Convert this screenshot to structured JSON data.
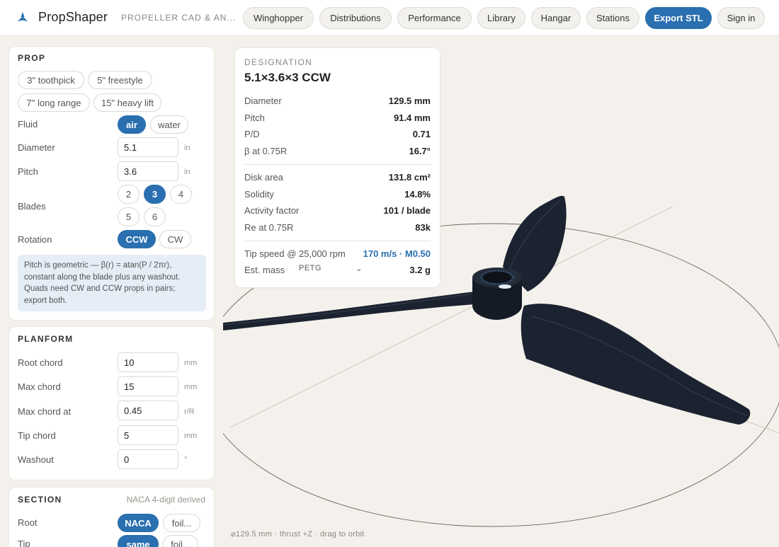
{
  "header": {
    "brand": "PropShaper",
    "tagline": "PROPELLER CAD & AN...",
    "nav": [
      {
        "label": "Winghopper"
      },
      {
        "label": "Distributions"
      },
      {
        "label": "Performance"
      },
      {
        "label": "Library"
      },
      {
        "label": "Hangar"
      },
      {
        "label": "Stations"
      },
      {
        "label": "Export STL"
      },
      {
        "label": "Sign in"
      }
    ],
    "accent_color": "#2a6fb0"
  },
  "prop": {
    "title": "PROP",
    "presets": [
      "3\" toothpick",
      "5\" freestyle",
      "7\" long range",
      "15\" heavy lift"
    ],
    "fluid": {
      "label": "Fluid",
      "options": [
        "air",
        "water"
      ],
      "selected": "air"
    },
    "diameter": {
      "label": "Diameter",
      "value": "5.1",
      "unit": "in"
    },
    "pitch": {
      "label": "Pitch",
      "value": "3.6",
      "unit": "in"
    },
    "blades": {
      "label": "Blades",
      "options": [
        "2",
        "3",
        "4",
        "5",
        "6"
      ],
      "selected": "3"
    },
    "rotation": {
      "label": "Rotation",
      "options": [
        "CCW",
        "CW"
      ],
      "selected": "CCW"
    },
    "info": "Pitch is geometric — β(r) = atan(P / 2πr), constant along the blade plus any washout. Quads need CW and CCW props in pairs; export both."
  },
  "planform": {
    "title": "PLANFORM",
    "fields": [
      {
        "label": "Root chord",
        "value": "10",
        "unit": "mm"
      },
      {
        "label": "Max chord",
        "value": "15",
        "unit": "mm"
      },
      {
        "label": "Max chord at",
        "value": "0.45",
        "unit": "r/R"
      },
      {
        "label": "Tip chord",
        "value": "5",
        "unit": "mm"
      },
      {
        "label": "Washout",
        "value": "0",
        "unit": "°"
      }
    ]
  },
  "section": {
    "title": "SECTION",
    "note": "NACA 4-digit derived",
    "root": {
      "label": "Root",
      "options": [
        "NACA",
        "foil..."
      ],
      "selected": "NACA"
    },
    "tip": {
      "label": "Tip",
      "options": [
        "same",
        "foil..."
      ],
      "selected": "same"
    }
  },
  "designation": {
    "label": "DESIGNATION",
    "title": "5.1×3.6×3 CCW",
    "group1": [
      {
        "k": "Diameter",
        "v": "129.5 mm"
      },
      {
        "k": "Pitch",
        "v": "91.4 mm"
      },
      {
        "k": "P/D",
        "v": "0.71"
      },
      {
        "k": "β at 0.75R",
        "v": "16.7°"
      }
    ],
    "group2": [
      {
        "k": "Disk area",
        "v": "131.8 cm²"
      },
      {
        "k": "Solidity",
        "v": "14.8%"
      },
      {
        "k": "Activity factor",
        "v": "101 / blade"
      },
      {
        "k": "Re at 0.75R",
        "v": "83k"
      }
    ],
    "tip_speed": {
      "k": "Tip speed @ 25,000 rpm",
      "v": "170 m/s · M0.50"
    },
    "mass": {
      "k": "Est. mass",
      "material": "PETG",
      "v": "3.2 g"
    }
  },
  "viewport": {
    "caption": "⌀129.5 mm · thrust +Z · drag to orbit"
  }
}
